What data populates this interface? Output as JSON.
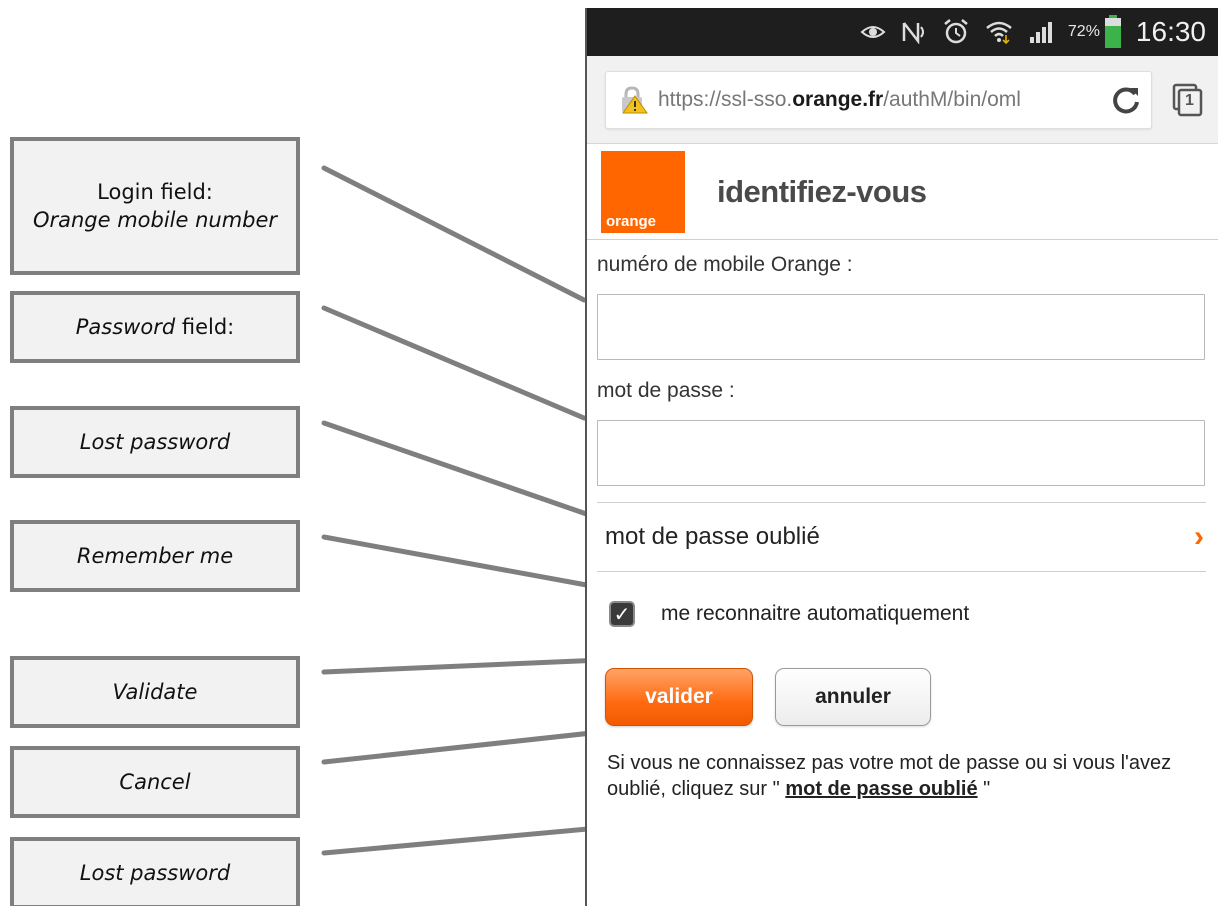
{
  "annotations": [
    {
      "label_line1": "Login field:",
      "label_italic": "Orange mobile number"
    },
    {
      "label_italic": "Password",
      "label_suffix": " field:"
    },
    {
      "label_italic": "Lost password"
    },
    {
      "label_italic": "Remember me"
    },
    {
      "label_italic": "Validate"
    },
    {
      "label_italic": "Cancel"
    },
    {
      "label_italic": "Lost password"
    }
  ],
  "status_bar": {
    "battery_percent": "72%",
    "time": "16:30",
    "icons": [
      "eye-icon",
      "nfc-icon",
      "alarm-icon",
      "wifi-icon",
      "signal-icon",
      "battery-icon"
    ]
  },
  "browser": {
    "url_prefix": "https://ssl-sso.",
    "url_host": "orange.fr",
    "url_path": "/authM/bin/oml",
    "lock_icon": "warning-lock-icon",
    "reload_icon": "reload-icon",
    "tabs_count": "1"
  },
  "page": {
    "logo_text": "orange",
    "title": "identifiez-vous",
    "mobile_label": "numéro de mobile Orange :",
    "mobile_value": "",
    "password_label": "mot de passe :",
    "password_value": "",
    "forgot_label": "mot de passe oublié",
    "forgot_chevron": "›",
    "remember_label": "me reconnaitre automatiquement",
    "remember_checked": true,
    "validate_label": "valider",
    "cancel_label": "annuler",
    "help_text_prefix": "Si vous ne connaissez pas votre mot de passe ou si vous l'avez oublié, cliquez sur \" ",
    "help_link": "mot de passe oublié",
    "help_text_suffix": " \""
  },
  "colors": {
    "brand_orange": "#ff6600",
    "status_bar": "#1e1e1e",
    "callout_border": "#7f7f7f"
  }
}
